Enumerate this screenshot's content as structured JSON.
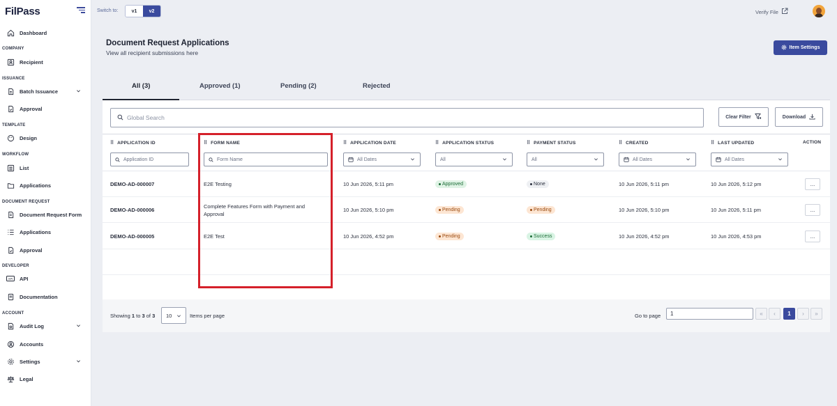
{
  "app": {
    "name": "FilPass"
  },
  "sidebar": {
    "sections": {
      "company": "COMPANY",
      "issuance": "ISSUANCE",
      "template": "TEMPLATE",
      "workflow": "WORKFLOW",
      "document_request": "DOCUMENT REQUEST",
      "developer": "DEVELOPER",
      "account": "ACCOUNT"
    },
    "items": {
      "dashboard": "Dashboard",
      "recipient": "Recipient",
      "batch_issuance": "Batch Issuance",
      "approval": "Approval",
      "design": "Design",
      "list": "List",
      "applications": "Applications",
      "document_request_form": "Document Request Form",
      "dr_applications": "Applications",
      "dr_approval": "Approval",
      "api": "API",
      "documentation": "Documentation",
      "audit_log": "Audit Log",
      "accounts": "Accounts",
      "settings": "Settings",
      "legal": "Legal"
    }
  },
  "topbar": {
    "switch_label": "Switch to:",
    "v1": "v1",
    "v2": "v2",
    "active_version": "v2",
    "verify_file": "Verify File"
  },
  "header": {
    "title": "Document Request Applications",
    "subtitle": "View all recipient submissions here",
    "item_settings": "Item Settings"
  },
  "tabs": [
    {
      "label": "All (3)",
      "active": true
    },
    {
      "label": "Approved (1)",
      "active": false
    },
    {
      "label": "Pending (2)",
      "active": false
    },
    {
      "label": "Rejected",
      "active": false
    }
  ],
  "toolbar": {
    "search_placeholder": "Global Search",
    "clear_filter": "Clear Filter",
    "download": "Download"
  },
  "columns": {
    "application_id": "APPLICATION ID",
    "form_name": "FORM NAME",
    "application_date": "APPLICATION DATE",
    "application_status": "APPLICATION STATUS",
    "payment_status": "PAYMENT STATUS",
    "created": "CREATED",
    "last_updated": "LAST UPDATED",
    "action": "ACTION"
  },
  "filters": {
    "application_id": "Application ID",
    "form_name": "Form Name",
    "application_date": "All Dates",
    "application_status": "All",
    "payment_status": "All",
    "created": "All Dates",
    "last_updated": "All Dates"
  },
  "rows": [
    {
      "id": "DEMO-AD-000007",
      "form_name": "E2E Testing",
      "application_date": "10 Jun 2026, 5:11 pm",
      "application_status": "Approved",
      "payment_status": "None",
      "created": "10 Jun 2026, 5:11 pm",
      "last_updated": "10 Jun 2026, 5:12 pm",
      "action": "..."
    },
    {
      "id": "DEMO-AD-000006",
      "form_name": "Complete Features Form with Payment and Approval",
      "application_date": "10 Jun 2026, 5:10 pm",
      "application_status": "Pending",
      "payment_status": "Pending",
      "created": "10 Jun 2026, 5:10 pm",
      "last_updated": "10 Jun 2026, 5:11 pm",
      "action": "..."
    },
    {
      "id": "DEMO-AD-000005",
      "form_name": "E2E Test",
      "application_date": "10 Jun 2026, 4:52 pm",
      "application_status": "Pending",
      "payment_status": "Success",
      "created": "10 Jun 2026, 4:52 pm",
      "last_updated": "10 Jun 2026, 4:53 pm",
      "action": "..."
    }
  ],
  "pagination": {
    "showing_prefix": "Showing",
    "from": "1",
    "to_word": "to",
    "to": "3",
    "of_word": "of",
    "total": "3",
    "per_page": "10",
    "items_per_page": "Items per page",
    "go_to_page": "Go to page",
    "page_input": "1",
    "first": "«",
    "prev": "‹",
    "current": "1",
    "next": "›",
    "last": "»"
  },
  "colors": {
    "primary": "#3a4a9e",
    "highlight": "#d5202a",
    "approved_bg": "#dff3e5",
    "pending_bg": "#fde6d3"
  }
}
